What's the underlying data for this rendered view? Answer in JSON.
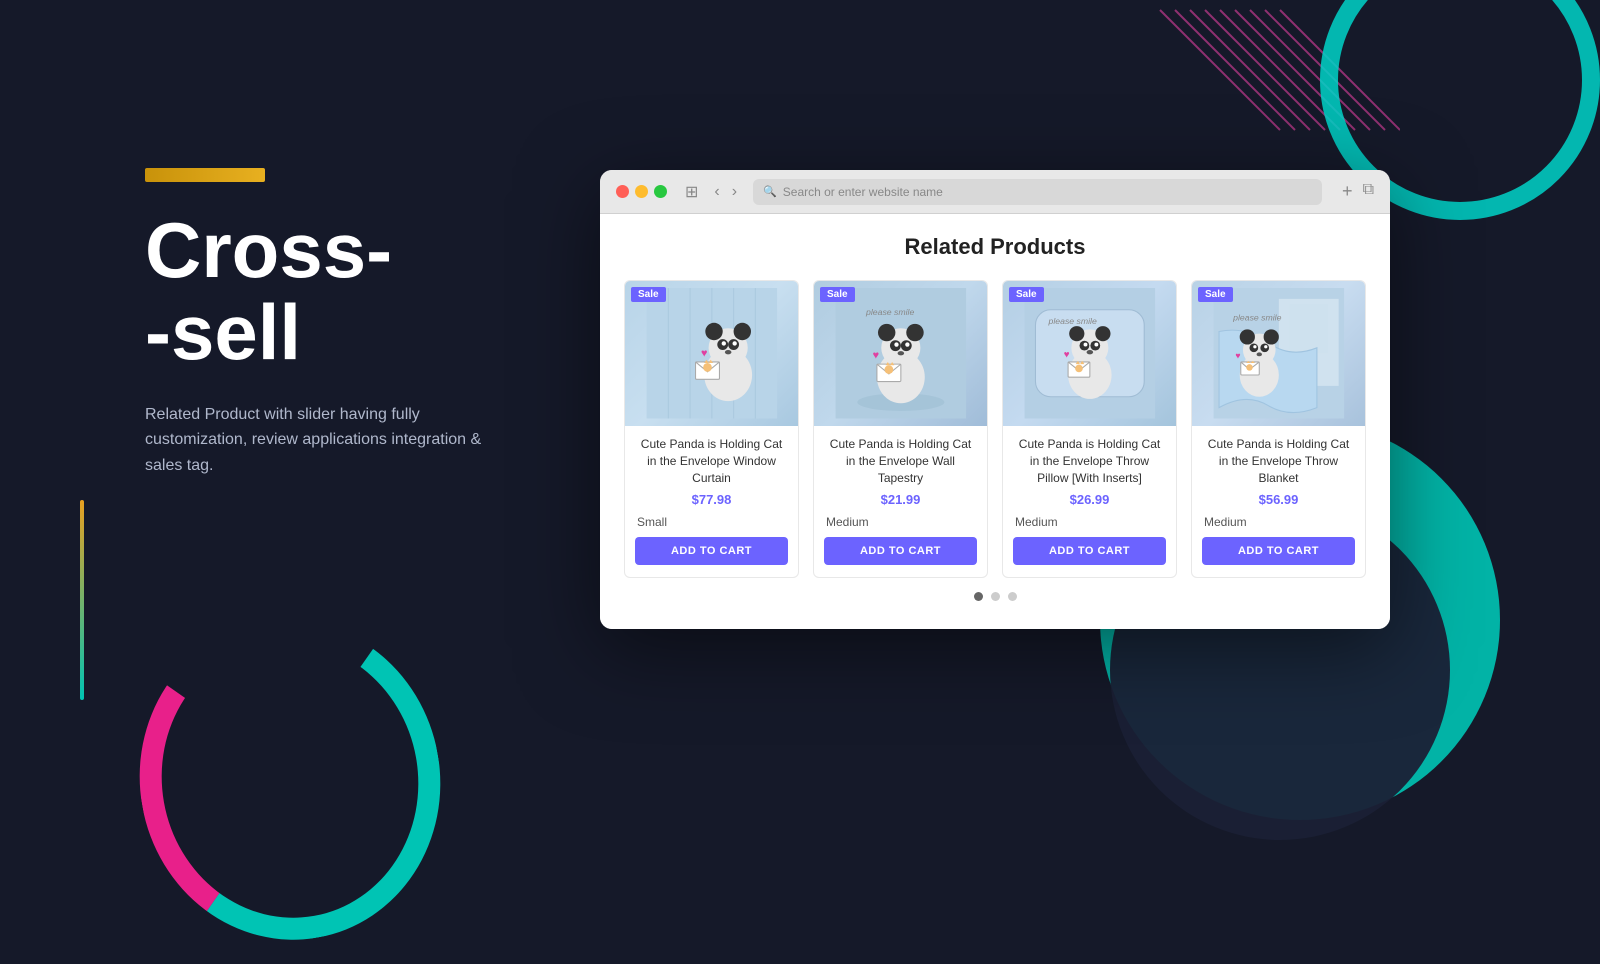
{
  "background": {
    "color": "#151929"
  },
  "left": {
    "accent_bar": "accent-bar",
    "title_line1": "Cross-",
    "title_line2": "-sell",
    "description": "Related Product with slider having fully customization, review applications integration & sales tag."
  },
  "browser": {
    "toolbar": {
      "address_placeholder": "Search or enter website name",
      "address_icon": "🔍"
    },
    "content": {
      "section_title": "Related Products",
      "products": [
        {
          "name": "Cute Panda is Holding Cat in the Envelope Window Curtain",
          "price": "$77.98",
          "badge": "Sale",
          "variant": "Small",
          "add_label": "ADD TO CART",
          "type": "curtain"
        },
        {
          "name": "Cute Panda is Holding Cat in the Envelope Wall Tapestry",
          "price": "$21.99",
          "badge": "Sale",
          "variant": "Medium",
          "add_label": "ADD TO CART",
          "type": "tapestry"
        },
        {
          "name": "Cute Panda is Holding Cat in the Envelope Throw Pillow [With Inserts]",
          "price": "$26.99",
          "badge": "Sale",
          "variant": "Medium",
          "add_label": "ADD TO CART",
          "type": "pillow"
        },
        {
          "name": "Cute Panda is Holding Cat in the Envelope Throw Blanket",
          "price": "$56.99",
          "badge": "Sale",
          "variant": "Medium",
          "add_label": "ADD TO CART",
          "type": "blanket"
        }
      ],
      "dots": [
        {
          "active": true
        },
        {
          "active": false
        },
        {
          "active": false
        }
      ]
    }
  }
}
